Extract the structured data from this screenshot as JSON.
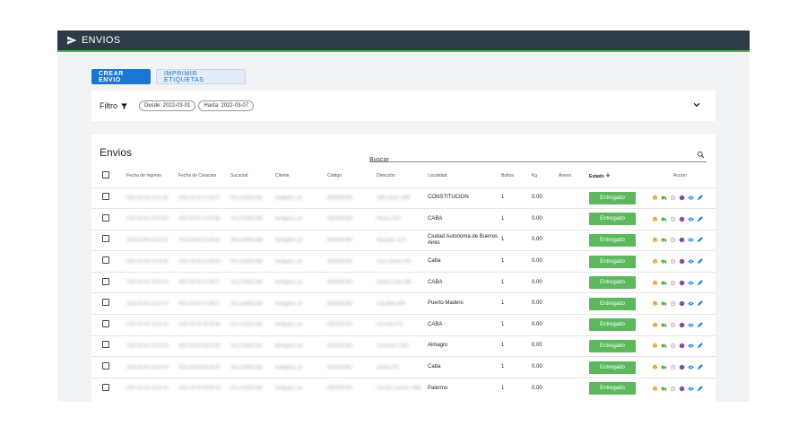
{
  "app": {
    "title": "ENVIOS"
  },
  "colors": {
    "topbar": "#2e3a45",
    "accent_line": "#4caf50",
    "primary": "#1976d2",
    "estado_badge": "#5cb85c"
  },
  "actions": {
    "crear_label": "CREAR ENVIO",
    "imprimir_label": "IMPRIMIR ETIQUETAS"
  },
  "filter": {
    "label": "Filtro",
    "desde_chip": "Desde: 2022-03-01",
    "hasta_chip": "Hasta: 2022-03-07"
  },
  "table": {
    "title": "Envios",
    "search_placeholder": "Buscar",
    "columns": {
      "fecha_ingreso": "Fecha de Ingreso",
      "fecha_creacion": "Fecha de Creacion",
      "sucursal": "Sucursal",
      "cliente": "Cliente",
      "codigo": "Código",
      "direccion": "Dirección",
      "localidad": "Localidad",
      "bultos": "Bultos",
      "kg": "Kg",
      "anexo": "Anexo",
      "estado": "Estado",
      "accion": "Accion"
    },
    "rows": [
      {
        "fi": "2022-03-04 13:01:58",
        "fc": "2022-03-04 12:45:57",
        "suc": "VILLA ADELINA",
        "cli": "textilgalos_ok",
        "cod": "0000002399",
        "dir": "SAN JOSE 1685",
        "loc": "CONSTITUCION",
        "bultos": "1",
        "kg": "0.00",
        "anexo": "",
        "estado": "Entregado"
      },
      {
        "fi": "2022-03-04 13:01:58",
        "fc": "2022-03-04 13:00:46",
        "suc": "VILLA ADELINA",
        "cli": "textilgalos_ok",
        "cod": "0000002398",
        "dir": "Moalla 2339",
        "loc": "CABA",
        "bultos": "1",
        "kg": "0.00",
        "anexo": "",
        "estado": "Entregado"
      },
      {
        "fi": "2022-03-04 13:02:01",
        "fc": "2022-03-04 11:08:44",
        "suc": "VILLA ADELINA",
        "cli": "textilgalos_ok",
        "cod": "0000002396",
        "dir": "Gonzalez 1121",
        "loc": "Ciudad Autonoma de Buenos Aires",
        "bultos": "1",
        "kg": "0.00",
        "anexo": "",
        "estado": "Entregado"
      },
      {
        "fi": "2022-03-04 13:02:06",
        "fc": "2022-03-04 11:08:33",
        "suc": "VILLA ADELINA",
        "cli": "textilgalos_ok",
        "cod": "0000002394",
        "dir": "Jose marmol 440",
        "loc": "Caba",
        "bultos": "1",
        "kg": "0.00",
        "anexo": "",
        "estado": "Entregado"
      },
      {
        "fi": "2022-03-04 13:02:16",
        "fc": "2022-03-04 11:08:37",
        "suc": "VILLA ADELINA",
        "cli": "textilgalos_ok",
        "cod": "0000002393",
        "dir": "Avellino Diaz 396",
        "loc": "CABA",
        "bultos": "1",
        "kg": "0.00",
        "anexo": "",
        "estado": "Entregado"
      },
      {
        "fi": "2022-03-04 13:02:16",
        "fc": "2022-03-04 11:08:22",
        "suc": "VILLA ADELINA",
        "cli": "textilgalos_ok",
        "cod": "0000002392",
        "dir": "Lola Mora 400",
        "loc": "Puerto Madero",
        "bultos": "1",
        "kg": "0.00",
        "anexo": "",
        "estado": "Entregado"
      },
      {
        "fi": "2022-03-04 13:02:19",
        "fc": "2022-03-04 06:05:48",
        "suc": "VILLA ADELINA",
        "cli": "textilgalos_ok",
        "cod": "0000002345",
        "dir": "Acevedo 373",
        "loc": "CABA",
        "bultos": "1",
        "kg": "0.00",
        "anexo": "",
        "estado": "Entregado"
      },
      {
        "fi": "2022-03-04 13:02:24",
        "fc": "2022-03-04 06:05:45",
        "suc": "VILLA ADELINA",
        "cli": "textilgalos_ok",
        "cod": "0000002344",
        "dir": "Corrientes 3945",
        "loc": "Almagro",
        "bultos": "1",
        "kg": "0.00",
        "anexo": "",
        "estado": "Entregado"
      },
      {
        "fi": "2022-03-04 13:02:24",
        "fc": "2022-03-04 06:05:35",
        "suc": "VILLA ADELINA",
        "cli": "textilgalos_ok",
        "cod": "0000002341",
        "dir": "Zavitia 373",
        "loc": "Caba",
        "bultos": "1",
        "kg": "0.00",
        "anexo": "",
        "estado": "Entregado"
      },
      {
        "fi": "2022-03-04 13:02:34",
        "fc": "2022-03-04 06:05:14",
        "suc": "VILLA ADELINA",
        "cli": "textilgalos_ok",
        "cod": "0000002339",
        "dir": "Avenida Leandro 4982",
        "loc": "Palermo",
        "bultos": "1",
        "kg": "0.00",
        "anexo": "",
        "estado": "Entregado"
      }
    ],
    "action_icons": [
      "printer-icon",
      "truck-icon",
      "target-icon",
      "package-icon",
      "eye-icon",
      "pencil-icon"
    ]
  }
}
